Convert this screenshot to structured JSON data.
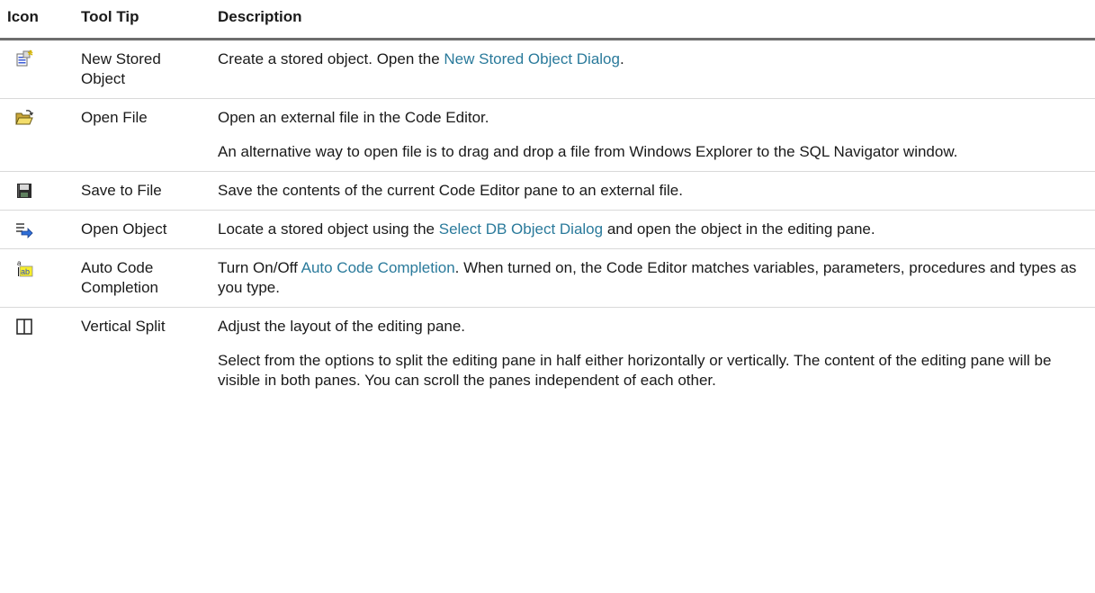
{
  "header": {
    "icon_label": "Icon",
    "tooltip_label": "Tool Tip",
    "description_label": "Description"
  },
  "rows": [
    {
      "icon": "new-stored-object-icon",
      "tooltip": "New Stored Object",
      "paragraphs": [
        {
          "before": "Create a stored object. Open the ",
          "link": "New Stored Object Dialog",
          "after": "."
        }
      ]
    },
    {
      "icon": "open-folder-icon",
      "tooltip": "Open File",
      "paragraphs": [
        {
          "before": "Open an external file in the Code Editor."
        },
        {
          "before": "An alternative way to open file is to drag and drop a file from Windows Explorer to the SQL Navigator window."
        }
      ]
    },
    {
      "icon": "floppy-disk-icon",
      "tooltip": "Save to File",
      "paragraphs": [
        {
          "before": "Save the contents of the current Code Editor pane to an external file."
        }
      ]
    },
    {
      "icon": "open-object-icon",
      "tooltip": "Open Object",
      "paragraphs": [
        {
          "before": "Locate a stored object using the ",
          "link": "Select DB Object Dialog",
          "after": " and open the object in the editing pane."
        }
      ]
    },
    {
      "icon": "auto-code-completion-icon",
      "tooltip": "Auto Code Completion",
      "paragraphs": [
        {
          "before": "Turn On/Off ",
          "link": "Auto Code Completion",
          "after": ". When turned on, the Code Editor matches variables, parameters, procedures and types as you type."
        }
      ]
    },
    {
      "icon": "vertical-split-icon",
      "tooltip": "Vertical Split",
      "paragraphs": [
        {
          "before": "Adjust the layout of the editing pane."
        },
        {
          "before": "Select from the options to split the editing pane in half either horizontally or vertically. The content of the editing pane will be visible in both panes. You can scroll the panes independent of each other."
        }
      ]
    }
  ],
  "colors": {
    "link": "#2a7a9b",
    "header_rule": "#6d6d6d",
    "row_rule": "#d9d9d9"
  }
}
